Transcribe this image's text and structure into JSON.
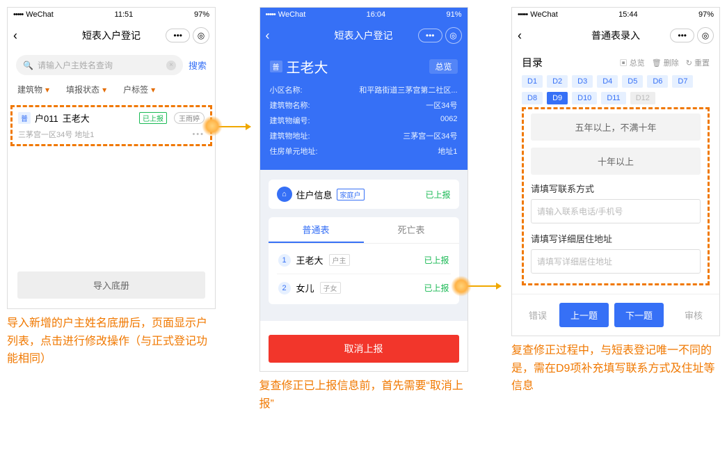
{
  "screen1": {
    "carrier": "WeChat",
    "time": "11:51",
    "battery": "97%",
    "title": "短表入户登记",
    "search_placeholder": "请输入户主姓名查询",
    "search_btn": "搜索",
    "filter1": "建筑物",
    "filter2": "填报状态",
    "filter3": "户标签",
    "card": {
      "badge": "普",
      "code": "户011",
      "name": "王老大",
      "status": "已上报",
      "reporter": "王雨婷",
      "addr": "三茅宫一区34号 地址1",
      "more": "•••"
    },
    "import_btn": "导入底册",
    "caption": "导入新增的户主姓名底册后，页面显示户列表，点击进行修改操作（与正式登记功能相同）"
  },
  "screen2": {
    "carrier": "WeChat",
    "time": "16:04",
    "battery": "91%",
    "title": "短表入户登记",
    "name_badge": "普",
    "name": "王老大",
    "overview": "总览",
    "kv": [
      {
        "k": "小区名称:",
        "v": "和平路街道三茅宫第二社区..."
      },
      {
        "k": "建筑物名称:",
        "v": "一区34号"
      },
      {
        "k": "建筑物编号:",
        "v": "0062"
      },
      {
        "k": "建筑物地址:",
        "v": "三茅宫一区34号"
      },
      {
        "k": "住房单元地址:",
        "v": "地址1"
      }
    ],
    "hh_label": "住户信息",
    "hh_type": "家庭户",
    "hh_status": "已上报",
    "tab1": "普通表",
    "tab2": "死亡表",
    "p1": {
      "num": "1",
      "name": "王老大",
      "rel": "户主",
      "status": "已上报"
    },
    "p2": {
      "num": "2",
      "name": "女儿",
      "rel": "子女",
      "status": "已上报"
    },
    "cancel": "取消上报",
    "caption": "复查修正已上报信息前，首先需要“取消上报”"
  },
  "screen3": {
    "carrier": "WeChat",
    "time": "15:44",
    "battery": "97%",
    "title": "普通表录入",
    "dir": "目录",
    "act1": "总览",
    "act2": "删除",
    "act3": "重置",
    "chips": [
      "D1",
      "D2",
      "D3",
      "D4",
      "D5",
      "D6",
      "D7",
      "D8",
      "D9",
      "D10",
      "D11",
      "D12"
    ],
    "chip_active": "D9",
    "chip_disabled": "D12",
    "opt1": "五年以上，不满十年",
    "opt2": "十年以上",
    "fld1_label": "请填写联系方式",
    "fld1_ph": "请输入联系电话/手机号",
    "fld2_label": "请填写详细居住地址",
    "fld2_ph": "请填写详细居住地址",
    "f_err": "错误",
    "f_prev": "上一题",
    "f_next": "下一题",
    "f_audit": "审核",
    "caption": "复查修正过程中，与短表登记唯一不同的是，需在D9项补充填写联系方式及住址等信息"
  }
}
